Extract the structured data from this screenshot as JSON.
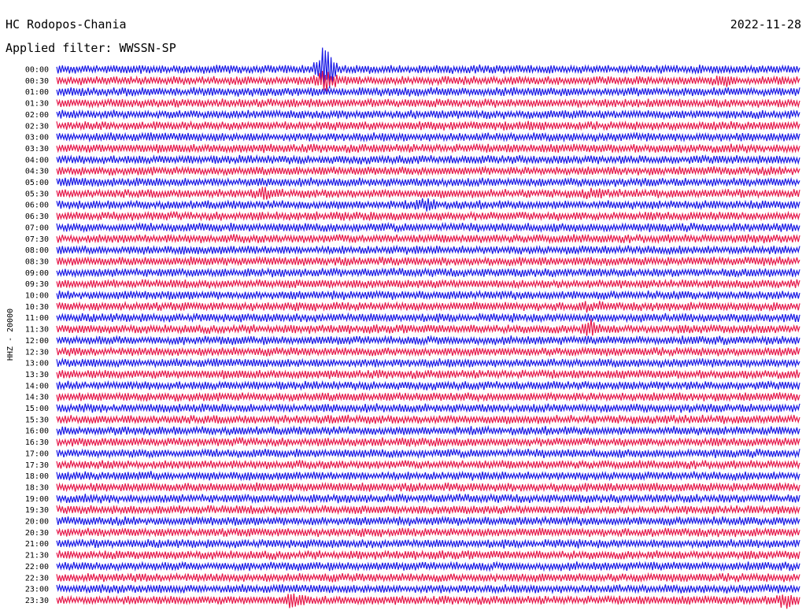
{
  "header": {
    "station": "HC Rodopos-Chania",
    "date": "2022-11-28",
    "filter": "Applied filter: WWSSN-SP"
  },
  "chart_data": {
    "type": "line",
    "ylabel": "HHZ - 20000",
    "row_labels": [
      "00:00",
      "00:30",
      "01:00",
      "01:30",
      "02:00",
      "02:30",
      "03:00",
      "03:30",
      "04:00",
      "04:30",
      "05:00",
      "05:30",
      "06:00",
      "06:30",
      "07:00",
      "07:30",
      "08:00",
      "08:30",
      "09:00",
      "09:30",
      "10:00",
      "10:30",
      "11:00",
      "11:30",
      "12:00",
      "12:30",
      "13:00",
      "13:30",
      "14:00",
      "14:30",
      "15:00",
      "15:30",
      "16:00",
      "16:30",
      "17:00",
      "17:30",
      "18:00",
      "18:30",
      "19:00",
      "19:30",
      "20:00",
      "20:30",
      "21:00",
      "21:30",
      "22:00",
      "22:30",
      "23:00",
      "23:30"
    ],
    "colors": [
      "#1a1ae6",
      "#e6194b"
    ],
    "events": [
      {
        "row": 0,
        "x": 0.362,
        "amp": 7.0
      },
      {
        "row": 1,
        "x": 0.362,
        "amp": 3.0
      },
      {
        "row": 1,
        "x": 0.9,
        "amp": 1.6
      },
      {
        "row": 5,
        "x": 0.64,
        "amp": 1.4
      },
      {
        "row": 10,
        "x": 0.02,
        "amp": 1.6
      },
      {
        "row": 11,
        "x": 0.28,
        "amp": 1.6
      },
      {
        "row": 11,
        "x": 0.72,
        "amp": 1.5
      },
      {
        "row": 12,
        "x": 0.5,
        "amp": 2.2
      },
      {
        "row": 21,
        "x": 0.72,
        "amp": 1.6
      },
      {
        "row": 23,
        "x": 0.72,
        "amp": 2.2
      },
      {
        "row": 36,
        "x": 0.12,
        "amp": 1.3
      },
      {
        "row": 47,
        "x": 0.32,
        "amp": 2.0
      },
      {
        "row": 47,
        "x": 0.98,
        "amp": 2.2
      }
    ]
  }
}
